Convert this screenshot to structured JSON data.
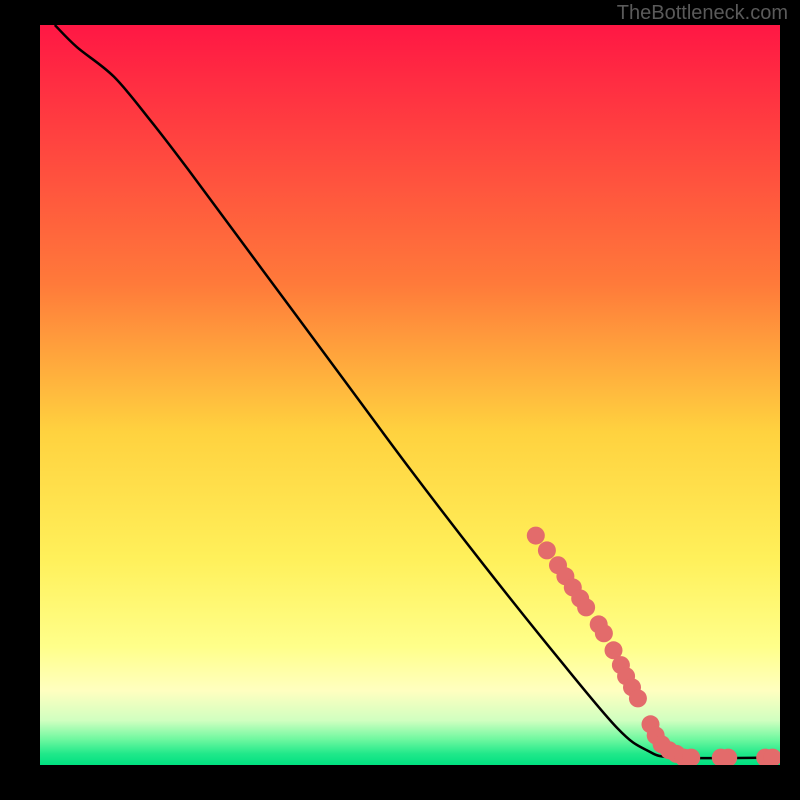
{
  "watermark": "TheBottleneck.com",
  "chart_data": {
    "type": "line",
    "title": "",
    "xlabel": "",
    "ylabel": "",
    "xlim": [
      0,
      100
    ],
    "ylim": [
      0,
      100
    ],
    "gradient_stops": [
      {
        "offset": 0,
        "color": "#ff1744"
      },
      {
        "offset": 0.35,
        "color": "#ff7a3a"
      },
      {
        "offset": 0.55,
        "color": "#ffd23f"
      },
      {
        "offset": 0.72,
        "color": "#fff05a"
      },
      {
        "offset": 0.84,
        "color": "#ffff8a"
      },
      {
        "offset": 0.9,
        "color": "#ffffc0"
      },
      {
        "offset": 0.94,
        "color": "#d0ffc0"
      },
      {
        "offset": 0.965,
        "color": "#70f8a0"
      },
      {
        "offset": 0.985,
        "color": "#20e88a"
      },
      {
        "offset": 1.0,
        "color": "#00e080"
      }
    ],
    "curve": [
      {
        "x": 2,
        "y": 100
      },
      {
        "x": 5,
        "y": 97
      },
      {
        "x": 10,
        "y": 93
      },
      {
        "x": 15,
        "y": 87
      },
      {
        "x": 20,
        "y": 80.5
      },
      {
        "x": 30,
        "y": 67
      },
      {
        "x": 40,
        "y": 53.5
      },
      {
        "x": 50,
        "y": 40
      },
      {
        "x": 60,
        "y": 27
      },
      {
        "x": 70,
        "y": 14.5
      },
      {
        "x": 78,
        "y": 5
      },
      {
        "x": 82,
        "y": 2
      },
      {
        "x": 86,
        "y": 1
      },
      {
        "x": 100,
        "y": 1
      }
    ],
    "markers": [
      {
        "x": 67,
        "y": 31
      },
      {
        "x": 68.5,
        "y": 29
      },
      {
        "x": 70,
        "y": 27
      },
      {
        "x": 71,
        "y": 25.5
      },
      {
        "x": 72,
        "y": 24
      },
      {
        "x": 73,
        "y": 22.5
      },
      {
        "x": 73.8,
        "y": 21.3
      },
      {
        "x": 75.5,
        "y": 19
      },
      {
        "x": 76.2,
        "y": 17.8
      },
      {
        "x": 77.5,
        "y": 15.5
      },
      {
        "x": 78.5,
        "y": 13.5
      },
      {
        "x": 79.2,
        "y": 12
      },
      {
        "x": 80,
        "y": 10.5
      },
      {
        "x": 80.8,
        "y": 9
      },
      {
        "x": 82.5,
        "y": 5.5
      },
      {
        "x": 83.2,
        "y": 4
      },
      {
        "x": 84,
        "y": 2.8
      },
      {
        "x": 85,
        "y": 2
      },
      {
        "x": 86,
        "y": 1.5
      },
      {
        "x": 87,
        "y": 1
      },
      {
        "x": 88,
        "y": 1
      },
      {
        "x": 92,
        "y": 1
      },
      {
        "x": 93,
        "y": 1
      },
      {
        "x": 98,
        "y": 1
      },
      {
        "x": 99,
        "y": 1
      }
    ],
    "marker_color": "#e36b6b",
    "marker_radius": 9,
    "curve_color": "#000000"
  }
}
